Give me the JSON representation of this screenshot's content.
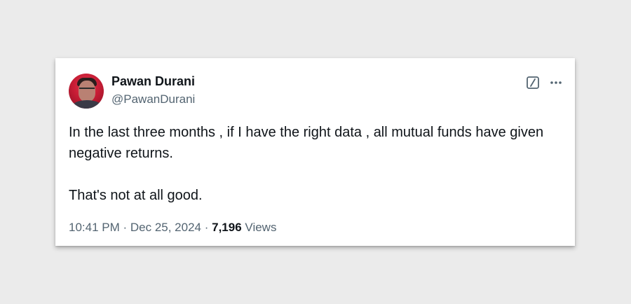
{
  "author": {
    "name": "Pawan Durani",
    "handle": "@PawanDurani"
  },
  "tweet": {
    "text": "In the last three months , if I have the right data , all mutual funds have given negative returns.\n\nThat's not at all good."
  },
  "meta": {
    "time": "10:41 PM",
    "separator": " · ",
    "date": "Dec 25, 2024",
    "views_count": "7,196",
    "views_label": "Views"
  },
  "icons": {
    "grok": "grok-slash-icon",
    "more": "more-dots-icon"
  },
  "colors": {
    "background": "#ebebeb",
    "card": "#ffffff",
    "text_primary": "#0f1419",
    "text_secondary": "#536471",
    "avatar_red": "#c81d35"
  }
}
